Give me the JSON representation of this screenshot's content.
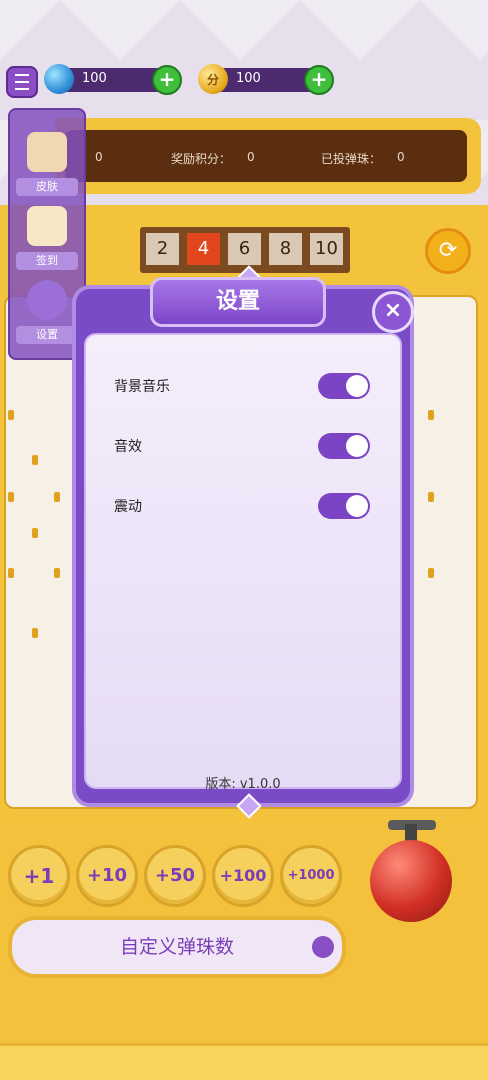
{
  "currency": {
    "gems": "100",
    "points_icon": "分",
    "points": "100"
  },
  "score_bar": {
    "first_value": "0",
    "reward_label": "奖励积分：",
    "reward_value": "0",
    "dropped_label": "已投弹珠：",
    "dropped_value": "0"
  },
  "slots": [
    "2",
    "4",
    "6",
    "8",
    "10"
  ],
  "side_menu": [
    {
      "label": "皮肤",
      "icon": "palette-icon"
    },
    {
      "label": "签到",
      "icon": "calendar-check-icon"
    },
    {
      "label": "设置",
      "icon": "gear-icon"
    }
  ],
  "chips": [
    "+1",
    "+10",
    "+50",
    "+100",
    "+1000"
  ],
  "custom_button": "自定义弹珠数",
  "dialog": {
    "title": "设置",
    "close_icon": "×",
    "settings": [
      {
        "label": "背景音乐",
        "on": true
      },
      {
        "label": "音效",
        "on": true
      },
      {
        "label": "震动",
        "on": true
      }
    ],
    "version": "版本: v1.0.0"
  },
  "colors": {
    "dialog": "#7a4bc6",
    "toggle_on": "#7b44c4",
    "cabinet": "#f2c33b"
  }
}
